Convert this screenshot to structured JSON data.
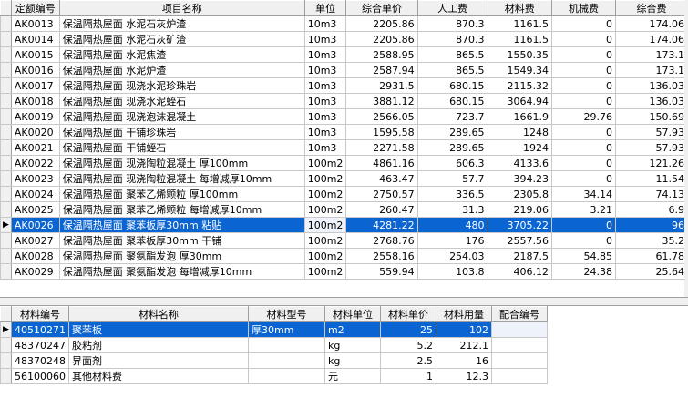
{
  "quota_table": {
    "columns": [
      "定额编号",
      "项目名称",
      "单位",
      "综合单价",
      "人工费",
      "材料费",
      "机械费",
      "综合费"
    ],
    "selected_index": 13,
    "rows": [
      [
        "AK0013",
        "保温隔热屋面 水泥石灰炉渣",
        "10m3",
        "2205.86",
        "870.3",
        "1161.5",
        "0",
        "174.06"
      ],
      [
        "AK0014",
        "保温隔热屋面 水泥石灰矿渣",
        "10m3",
        "2205.86",
        "870.3",
        "1161.5",
        "0",
        "174.06"
      ],
      [
        "AK0015",
        "保温隔热屋面 水泥焦渣",
        "10m3",
        "2588.95",
        "865.5",
        "1550.35",
        "0",
        "173.1"
      ],
      [
        "AK0016",
        "保温隔热屋面 水泥炉渣",
        "10m3",
        "2587.94",
        "865.5",
        "1549.34",
        "0",
        "173.1"
      ],
      [
        "AK0017",
        "保温隔热屋面 现浇水泥珍珠岩",
        "10m3",
        "2931.5",
        "680.15",
        "2115.32",
        "0",
        "136.03"
      ],
      [
        "AK0018",
        "保温隔热屋面 现浇水泥蛭石",
        "10m3",
        "3881.12",
        "680.15",
        "3064.94",
        "0",
        "136.03"
      ],
      [
        "AK0019",
        "保温隔热屋面 现浇泡沫混凝土",
        "10m3",
        "2566.05",
        "723.7",
        "1661.9",
        "29.76",
        "150.69"
      ],
      [
        "AK0020",
        "保温隔热屋面 干铺珍珠岩",
        "10m3",
        "1595.58",
        "289.65",
        "1248",
        "0",
        "57.93"
      ],
      [
        "AK0021",
        "保温隔热屋面 干铺蛭石",
        "10m3",
        "2271.58",
        "289.65",
        "1924",
        "0",
        "57.93"
      ],
      [
        "AK0022",
        "保温隔热屋面 现浇陶粒混凝土 厚100mm",
        "100m2",
        "4861.16",
        "606.3",
        "4133.6",
        "0",
        "121.26"
      ],
      [
        "AK0023",
        "保温隔热屋面 现浇陶粒混凝土 每增减厚10mm",
        "100m2",
        "463.47",
        "57.7",
        "394.23",
        "0",
        "11.54"
      ],
      [
        "AK0024",
        "保温隔热屋面 聚苯乙烯颗粒 厚100mm",
        "100m2",
        "2750.57",
        "336.5",
        "2305.8",
        "34.14",
        "74.13"
      ],
      [
        "AK0025",
        "保温隔热屋面 聚苯乙烯颗粒 每增减厚10mm",
        "100m2",
        "260.47",
        "31.3",
        "219.06",
        "3.21",
        "6.9"
      ],
      [
        "AK0026",
        "保温隔热屋面 聚苯板厚30mm 粘贴",
        "100m2",
        "4281.22",
        "480",
        "3705.22",
        "0",
        "96"
      ],
      [
        "AK0027",
        "保温隔热屋面 聚苯板厚30mm 干铺",
        "100m2",
        "2768.76",
        "176",
        "2557.56",
        "0",
        "35.2"
      ],
      [
        "AK0028",
        "保温隔热屋面 聚氨酯发泡 厚30mm",
        "100m2",
        "2558.16",
        "254.03",
        "2187.5",
        "54.85",
        "61.78"
      ],
      [
        "AK0029",
        "保温隔热屋面 聚氨酯发泡 每增减厚10mm",
        "100m2",
        "559.94",
        "103.8",
        "406.12",
        "24.38",
        "25.64"
      ]
    ]
  },
  "material_table": {
    "columns": [
      "材料编号",
      "材料名称",
      "材料型号",
      "材料单位",
      "材料单价",
      "材料用量",
      "配合编号"
    ],
    "selected_index": 0,
    "rows": [
      [
        "40510271",
        "聚苯板",
        "厚30mm",
        "m2",
        "25",
        "102",
        ""
      ],
      [
        "48370247",
        "胶粘剂",
        "",
        "kg",
        "5.2",
        "212.1",
        ""
      ],
      [
        "48370248",
        "界面剂",
        "",
        "kg",
        "2.5",
        "16",
        ""
      ],
      [
        "56100060",
        "其他材料费",
        "",
        "元",
        "1",
        "12.3",
        ""
      ]
    ]
  },
  "icons": {
    "row_indicator": "▶"
  }
}
